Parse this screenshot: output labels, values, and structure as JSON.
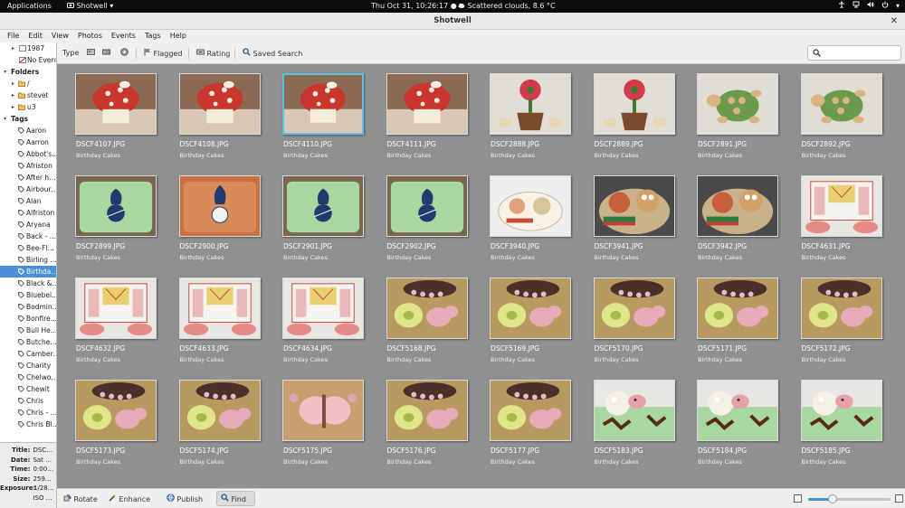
{
  "topbar": {
    "applications": "Applications",
    "app_name": "Shotwell",
    "clock": "Thu Oct 31, 10:26:17",
    "weather": "Scattered clouds, 8.6 °C"
  },
  "window": {
    "title": "Shotwell"
  },
  "menubar": [
    "File",
    "Edit",
    "View",
    "Photos",
    "Events",
    "Tags",
    "Help"
  ],
  "sidebar": {
    "events": [
      {
        "label": "1987",
        "expander": "▸"
      },
      {
        "label": "No Event"
      }
    ],
    "folders_header": "Folders",
    "folders": [
      {
        "label": "/"
      },
      {
        "label": "stevet"
      },
      {
        "label": "u3"
      }
    ],
    "tags_header": "Tags",
    "tags": [
      "Aaron",
      "Aarron",
      "Abbot's…",
      "Afriston",
      "After h…",
      "Airbour…",
      "Alan",
      "Alfriston",
      "Aryana",
      "Back - …",
      "Bee-Fl…",
      "Birling …",
      "Birthda…",
      "Black &…",
      "Bluebel…",
      "Bodmin…",
      "Bonfire…",
      "Bull He…",
      "Butche…",
      "Camber…",
      "Charity",
      "Chelwo…",
      "Chewit",
      "Chris",
      "Chris - …",
      "Chris Bl…"
    ],
    "selected_tag_index": 12
  },
  "metadata": [
    {
      "key": "Title:",
      "value": "DSC…"
    },
    {
      "key": "Date:",
      "value": "Sat …"
    },
    {
      "key": "Time:",
      "value": "0:00…"
    },
    {
      "key": "Size:",
      "value": "259…"
    },
    {
      "key": "Exposure:",
      "value": "1/28…"
    },
    {
      "key": "",
      "value": "ISO …"
    }
  ],
  "toolbar": {
    "type_label": "Type",
    "flagged_label": "Flagged",
    "rating_label": "Rating",
    "saved_search_label": "Saved Search",
    "search_placeholder": ""
  },
  "photos": [
    {
      "name": "DSCF4107.JPG",
      "event": "Birthday Cakes",
      "subject": "mushroom-cake"
    },
    {
      "name": "DSCF4108.JPG",
      "event": "Birthday Cakes",
      "subject": "mushroom-cake"
    },
    {
      "name": "DSCF4110.JPG",
      "event": "Birthday Cakes",
      "subject": "mushroom-cake",
      "selected": true
    },
    {
      "name": "DSCF4111.JPG",
      "event": "Birthday Cakes",
      "subject": "mushroom-cake"
    },
    {
      "name": "DSCF2888.JPG",
      "event": "Birthday Cakes",
      "subject": "flowerpot-cake"
    },
    {
      "name": "DSCF2889.JPG",
      "event": "Birthday Cakes",
      "subject": "flowerpot-cake"
    },
    {
      "name": "DSCF2891.JPG",
      "event": "Birthday Cakes",
      "subject": "turtle-cake"
    },
    {
      "name": "DSCF2892.JPG",
      "event": "Birthday Cakes",
      "subject": "turtle-cake"
    },
    {
      "name": "DSCF2899.JPG",
      "event": "Birthday Cakes",
      "subject": "spurs-cake-green"
    },
    {
      "name": "DSCF2900.JPG",
      "event": "Birthday Cakes",
      "subject": "spurs-cake-orange"
    },
    {
      "name": "DSCF2901.JPG",
      "event": "Birthday Cakes",
      "subject": "spurs-cake-green"
    },
    {
      "name": "DSCF2902.JPG",
      "event": "Birthday Cakes",
      "subject": "spurs-cake-green"
    },
    {
      "name": "DSCF3940.JPG",
      "event": "Birthday Cakes",
      "subject": "wallace-cake-light"
    },
    {
      "name": "DSCF3941.JPG",
      "event": "Birthday Cakes",
      "subject": "wallace-cake"
    },
    {
      "name": "DSCF3942.JPG",
      "event": "Birthday Cakes",
      "subject": "wallace-cake"
    },
    {
      "name": "DSCF4631.JPG",
      "event": "Birthday Cakes",
      "subject": "card-cake"
    },
    {
      "name": "DSCF4632.JPG",
      "event": "Birthday Cakes",
      "subject": "card-cake"
    },
    {
      "name": "DSCF4633.JPG",
      "event": "Birthday Cakes",
      "subject": "card-cake"
    },
    {
      "name": "DSCF4634.JPG",
      "event": "Birthday Cakes",
      "subject": "card-cake"
    },
    {
      "name": "DSCF5168.JPG",
      "event": "Birthday Cakes",
      "subject": "butterfly-cake"
    },
    {
      "name": "DSCF5169.JPG",
      "event": "Birthday Cakes",
      "subject": "butterfly-cake"
    },
    {
      "name": "DSCF5170.JPG",
      "event": "Birthday Cakes",
      "subject": "butterfly-cake"
    },
    {
      "name": "DSCF5171.JPG",
      "event": "Birthday Cakes",
      "subject": "butterfly-cake"
    },
    {
      "name": "DSCF5172.JPG",
      "event": "Birthday Cakes",
      "subject": "butterfly-cake"
    },
    {
      "name": "DSCF5173.JPG",
      "event": "Birthday Cakes",
      "subject": "butterfly-cake"
    },
    {
      "name": "DSCF5174.JPG",
      "event": "Birthday Cakes",
      "subject": "butterfly-cake"
    },
    {
      "name": "DSCF5175.JPG",
      "event": "Birthday Cakes",
      "subject": "butterfly-cake-pink"
    },
    {
      "name": "DSCF5176.JPG",
      "event": "Birthday Cakes",
      "subject": "butterfly-cake"
    },
    {
      "name": "DSCF5177.JPG",
      "event": "Birthday Cakes",
      "subject": "butterfly-cake"
    },
    {
      "name": "DSCF5183.JPG",
      "event": "Birthday Cakes",
      "subject": "sheep-cake"
    },
    {
      "name": "DSCF5184.JPG",
      "event": "Birthday Cakes",
      "subject": "sheep-cake"
    },
    {
      "name": "DSCF5185.JPG",
      "event": "Birthday Cakes",
      "subject": "sheep-cake"
    }
  ],
  "bottombar": {
    "rotate_label": "Rotate",
    "enhance_label": "Enhance",
    "publish_label": "Publish",
    "find_label": "Find",
    "zoom_level": 0.3
  },
  "colors": {
    "accent": "#4a90d9",
    "selection_border": "#5bc0e8",
    "grid_background": "#909090"
  }
}
